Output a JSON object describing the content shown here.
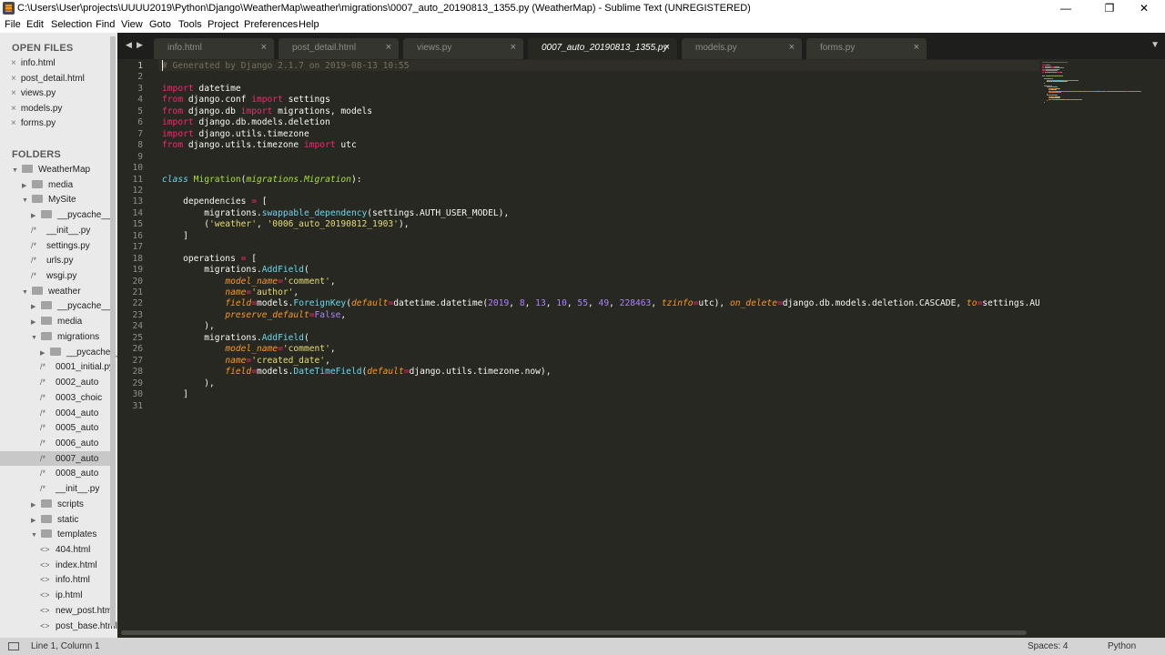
{
  "window": {
    "title": "C:\\Users\\User\\projects\\UUUU2019\\Python\\Django\\WeatherMap\\weather\\migrations\\0007_auto_20190813_1355.py (WeatherMap) - Sublime Text (UNREGISTERED)",
    "minimize": "—",
    "maximize": "❐",
    "close": "✕"
  },
  "menu": [
    "File",
    "Edit",
    "Selection",
    "Find",
    "View",
    "Goto",
    "Tools",
    "Project",
    "Preferences",
    "Help"
  ],
  "sidebar": {
    "open_files_header": "OPEN FILES",
    "open_files": [
      "info.html",
      "post_detail.html",
      "views.py",
      "models.py",
      "forms.py"
    ],
    "folders_header": "FOLDERS",
    "tree": [
      {
        "label": "WeatherMap",
        "type": "folder",
        "open": true,
        "depth": 0
      },
      {
        "label": "media",
        "type": "folder",
        "open": false,
        "depth": 1
      },
      {
        "label": "MySite",
        "type": "folder",
        "open": true,
        "depth": 1
      },
      {
        "label": "__pycache__",
        "type": "folder",
        "open": false,
        "depth": 2
      },
      {
        "label": "__init__.py",
        "type": "file",
        "icon": "/*",
        "depth": 2
      },
      {
        "label": "settings.py",
        "type": "file",
        "icon": "/*",
        "depth": 2
      },
      {
        "label": "urls.py",
        "type": "file",
        "icon": "/*",
        "depth": 2
      },
      {
        "label": "wsgi.py",
        "type": "file",
        "icon": "/*",
        "depth": 2
      },
      {
        "label": "weather",
        "type": "folder",
        "open": true,
        "depth": 1
      },
      {
        "label": "__pycache__",
        "type": "folder",
        "open": false,
        "depth": 2
      },
      {
        "label": "media",
        "type": "folder",
        "open": false,
        "depth": 2
      },
      {
        "label": "migrations",
        "type": "folder",
        "open": true,
        "depth": 2
      },
      {
        "label": "__pycache__",
        "type": "folder",
        "open": false,
        "depth": 3
      },
      {
        "label": "0001_initial.py",
        "type": "file",
        "icon": "/*",
        "depth": 3
      },
      {
        "label": "0002_auto",
        "type": "file",
        "icon": "/*",
        "depth": 3
      },
      {
        "label": "0003_choic",
        "type": "file",
        "icon": "/*",
        "depth": 3
      },
      {
        "label": "0004_auto",
        "type": "file",
        "icon": "/*",
        "depth": 3
      },
      {
        "label": "0005_auto",
        "type": "file",
        "icon": "/*",
        "depth": 3
      },
      {
        "label": "0006_auto",
        "type": "file",
        "icon": "/*",
        "depth": 3
      },
      {
        "label": "0007_auto",
        "type": "file",
        "icon": "/*",
        "depth": 3,
        "selected": true
      },
      {
        "label": "0008_auto",
        "type": "file",
        "icon": "/*",
        "depth": 3
      },
      {
        "label": "__init__.py",
        "type": "file",
        "icon": "/*",
        "depth": 3
      },
      {
        "label": "scripts",
        "type": "folder",
        "open": false,
        "depth": 2
      },
      {
        "label": "static",
        "type": "folder",
        "open": false,
        "depth": 2
      },
      {
        "label": "templates",
        "type": "folder",
        "open": true,
        "depth": 2
      },
      {
        "label": "404.html",
        "type": "file",
        "icon": "<>",
        "depth": 3
      },
      {
        "label": "index.html",
        "type": "file",
        "icon": "<>",
        "depth": 3
      },
      {
        "label": "info.html",
        "type": "file",
        "icon": "<>",
        "depth": 3
      },
      {
        "label": "ip.html",
        "type": "file",
        "icon": "<>",
        "depth": 3
      },
      {
        "label": "new_post.html",
        "type": "file",
        "icon": "<>",
        "depth": 3
      },
      {
        "label": "post_base.html",
        "type": "file",
        "icon": "<>",
        "depth": 3
      }
    ]
  },
  "tabs": [
    {
      "label": "info.html",
      "active": false
    },
    {
      "label": "post_detail.html",
      "active": false
    },
    {
      "label": "views.py",
      "active": false
    },
    {
      "label": "0007_auto_20190813_1355.py",
      "active": true
    },
    {
      "label": "models.py",
      "active": false
    },
    {
      "label": "forms.py",
      "active": false
    }
  ],
  "tab_close": "×",
  "editor": {
    "line_numbers": [
      "1",
      "2",
      "3",
      "4",
      "5",
      "6",
      "7",
      "8",
      "9",
      "10",
      "11",
      "12",
      "13",
      "14",
      "15",
      "16",
      "17",
      "18",
      "19",
      "20",
      "21",
      "22",
      "23",
      "24",
      "25",
      "26",
      "27",
      "28",
      "29",
      "30",
      "31"
    ],
    "lines": [
      [
        [
          "c",
          "# Generated by Django 2.1.7 on 2019-08-13 10:55"
        ]
      ],
      [],
      [
        [
          "k",
          "import"
        ],
        [
          "p",
          " datetime"
        ]
      ],
      [
        [
          "k",
          "from"
        ],
        [
          "p",
          " django.conf "
        ],
        [
          "k",
          "import"
        ],
        [
          "p",
          " settings"
        ]
      ],
      [
        [
          "k",
          "from"
        ],
        [
          "p",
          " django.db "
        ],
        [
          "k",
          "import"
        ],
        [
          "p",
          " migrations, models"
        ]
      ],
      [
        [
          "k",
          "import"
        ],
        [
          "p",
          " django.db.models.deletion"
        ]
      ],
      [
        [
          "k",
          "import"
        ],
        [
          "p",
          " django.utils.timezone"
        ]
      ],
      [
        [
          "k",
          "from"
        ],
        [
          "p",
          " django.utils.timezone "
        ],
        [
          "k",
          "import"
        ],
        [
          "p",
          " utc"
        ]
      ],
      [],
      [],
      [
        [
          "st",
          "class"
        ],
        [
          "p",
          " "
        ],
        [
          "cls-name",
          "Migration"
        ],
        [
          "p",
          "("
        ],
        [
          "base",
          "migrations.Migration"
        ],
        [
          "p",
          "):"
        ]
      ],
      [],
      [
        [
          "p",
          "    dependencies "
        ],
        [
          "k",
          "="
        ],
        [
          "p",
          " ["
        ]
      ],
      [
        [
          "p",
          "        migrations."
        ],
        [
          "fn",
          "swappable_dependency"
        ],
        [
          "p",
          "(settings.AUTH_USER_MODEL),"
        ]
      ],
      [
        [
          "p",
          "        ("
        ],
        [
          "s",
          "'weather'"
        ],
        [
          "p",
          ", "
        ],
        [
          "s",
          "'0006_auto_20190812_1903'"
        ],
        [
          "p",
          "),"
        ]
      ],
      [
        [
          "p",
          "    ]"
        ]
      ],
      [],
      [
        [
          "p",
          "    operations "
        ],
        [
          "k",
          "="
        ],
        [
          "p",
          " ["
        ]
      ],
      [
        [
          "p",
          "        migrations."
        ],
        [
          "fn",
          "AddField"
        ],
        [
          "p",
          "("
        ]
      ],
      [
        [
          "p",
          "            "
        ],
        [
          "a",
          "model_name"
        ],
        [
          "k",
          "="
        ],
        [
          "s",
          "'comment'"
        ],
        [
          "p",
          ","
        ]
      ],
      [
        [
          "p",
          "            "
        ],
        [
          "a",
          "name"
        ],
        [
          "k",
          "="
        ],
        [
          "s",
          "'author'"
        ],
        [
          "p",
          ","
        ]
      ],
      [
        [
          "p",
          "            "
        ],
        [
          "a",
          "field"
        ],
        [
          "k",
          "="
        ],
        [
          "p",
          "models."
        ],
        [
          "fn",
          "ForeignKey"
        ],
        [
          "p",
          "("
        ],
        [
          "a",
          "default"
        ],
        [
          "k",
          "="
        ],
        [
          "p",
          "datetime.datetime("
        ],
        [
          "n",
          "2019"
        ],
        [
          "p",
          ", "
        ],
        [
          "n",
          "8"
        ],
        [
          "p",
          ", "
        ],
        [
          "n",
          "13"
        ],
        [
          "p",
          ", "
        ],
        [
          "n",
          "10"
        ],
        [
          "p",
          ", "
        ],
        [
          "n",
          "55"
        ],
        [
          "p",
          ", "
        ],
        [
          "n",
          "49"
        ],
        [
          "p",
          ", "
        ],
        [
          "n",
          "228463"
        ],
        [
          "p",
          ", "
        ],
        [
          "a",
          "tzinfo"
        ],
        [
          "k",
          "="
        ],
        [
          "p",
          "utc), "
        ],
        [
          "a",
          "on_delete"
        ],
        [
          "k",
          "="
        ],
        [
          "p",
          "django.db.models.deletion.CASCADE, "
        ],
        [
          "a",
          "to"
        ],
        [
          "k",
          "="
        ],
        [
          "p",
          "settings.AUTH_USER_MODEL),"
        ]
      ],
      [
        [
          "p",
          "            "
        ],
        [
          "a",
          "preserve_default"
        ],
        [
          "k",
          "="
        ],
        [
          "n",
          "False"
        ],
        [
          "p",
          ","
        ]
      ],
      [
        [
          "p",
          "        ),"
        ]
      ],
      [
        [
          "p",
          "        migrations."
        ],
        [
          "fn",
          "AddField"
        ],
        [
          "p",
          "("
        ]
      ],
      [
        [
          "p",
          "            "
        ],
        [
          "a",
          "model_name"
        ],
        [
          "k",
          "="
        ],
        [
          "s",
          "'comment'"
        ],
        [
          "p",
          ","
        ]
      ],
      [
        [
          "p",
          "            "
        ],
        [
          "a",
          "name"
        ],
        [
          "k",
          "="
        ],
        [
          "s",
          "'created_date'"
        ],
        [
          "p",
          ","
        ]
      ],
      [
        [
          "p",
          "            "
        ],
        [
          "a",
          "field"
        ],
        [
          "k",
          "="
        ],
        [
          "p",
          "models."
        ],
        [
          "fn",
          "DateTimeField"
        ],
        [
          "p",
          "("
        ],
        [
          "a",
          "default"
        ],
        [
          "k",
          "="
        ],
        [
          "p",
          "django.utils.timezone.now),"
        ]
      ],
      [
        [
          "p",
          "        ),"
        ]
      ],
      [
        [
          "p",
          "    ]"
        ]
      ],
      []
    ]
  },
  "status": {
    "position": "Line 1, Column 1",
    "indent": "Spaces: 4",
    "syntax": "Python"
  },
  "colors": {
    "editor_bg": "#272822",
    "keyword": "#f92672",
    "string": "#e6db74",
    "number": "#ae81ff",
    "comment": "#75715e",
    "function": "#66d9ef",
    "argument": "#fd971f",
    "class_name": "#a6e22e"
  }
}
